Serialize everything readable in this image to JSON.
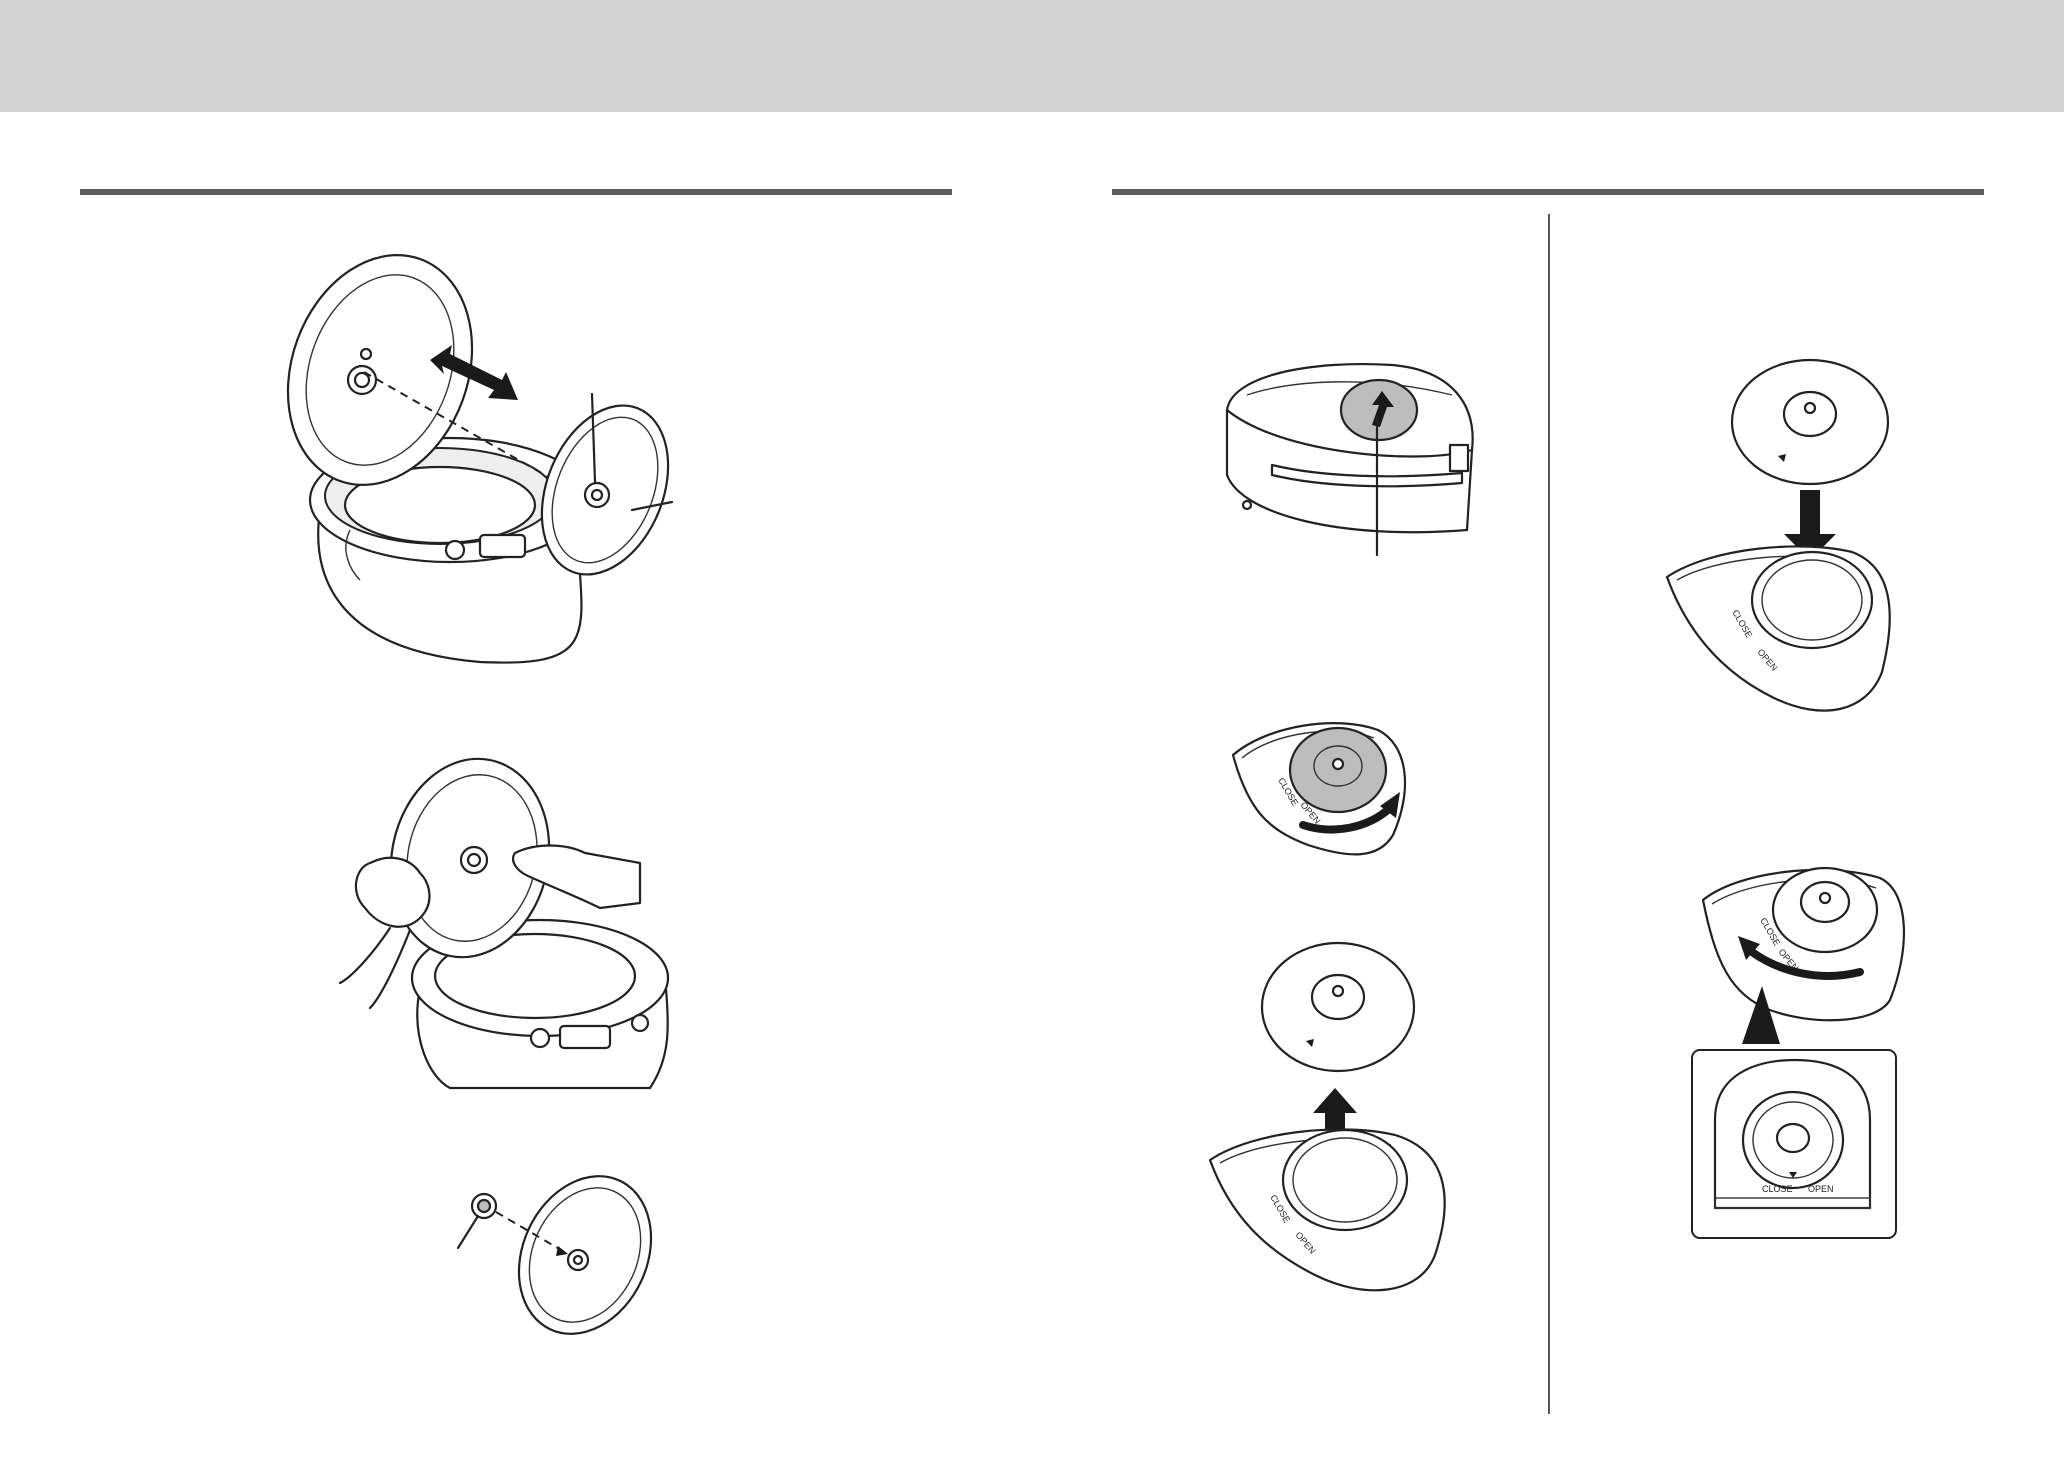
{
  "dial_labels": {
    "close": "CLOSE",
    "open": "OPEN"
  },
  "colors": {
    "header_band": "#d3d3d3",
    "section_rule": "#5e5e5e",
    "shaded_part": "#bdbdbd",
    "line_art": "#222222"
  }
}
